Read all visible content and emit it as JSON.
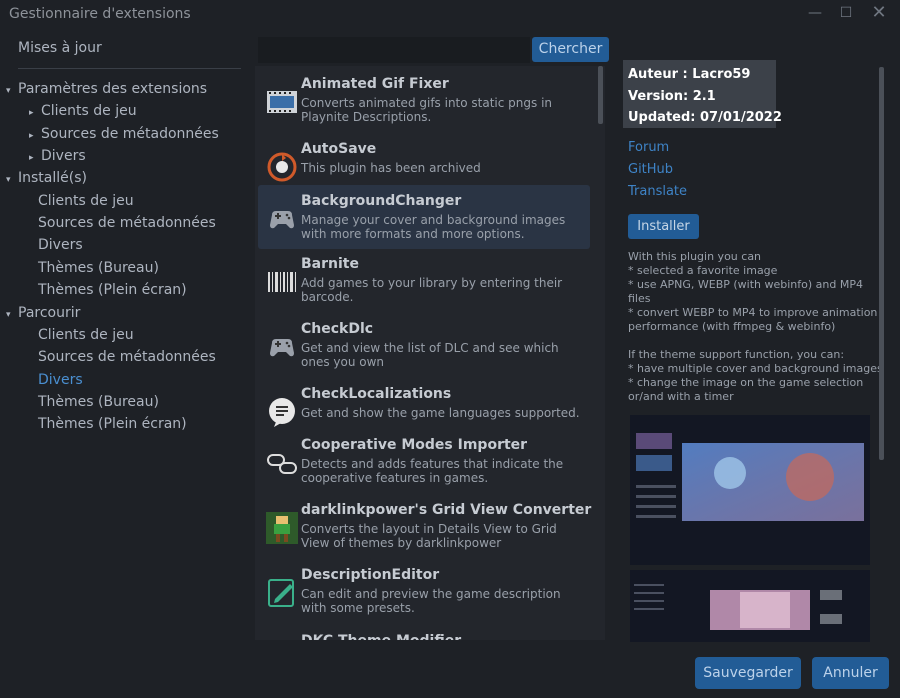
{
  "window": {
    "title": "Gestionnaire d'extensions"
  },
  "nav": {
    "updates": "Mises à jour",
    "rows": [
      {
        "label": "Paramètres des extensions",
        "arrow": "▾",
        "level": 0
      },
      {
        "label": "Clients de jeu",
        "arrow": "▸",
        "level": 1
      },
      {
        "label": "Sources de métadonnées",
        "arrow": "▸",
        "level": 1
      },
      {
        "label": "Divers",
        "arrow": "▸",
        "level": 1
      },
      {
        "label": "Installé(s)",
        "arrow": "▾",
        "level": 0
      },
      {
        "label": "Clients de jeu",
        "arrow": "",
        "level": 1
      },
      {
        "label": "Sources de métadonnées",
        "arrow": "",
        "level": 1
      },
      {
        "label": "Divers",
        "arrow": "",
        "level": 1
      },
      {
        "label": "Thèmes (Bureau)",
        "arrow": "",
        "level": 1
      },
      {
        "label": "Thèmes (Plein écran)",
        "arrow": "",
        "level": 1
      },
      {
        "label": "Parcourir",
        "arrow": "▾",
        "level": 0
      },
      {
        "label": "Clients de jeu",
        "arrow": "",
        "level": 1
      },
      {
        "label": "Sources de métadonnées",
        "arrow": "",
        "level": 1
      },
      {
        "label": "Divers",
        "arrow": "",
        "level": 1,
        "active": true
      },
      {
        "label": "Thèmes (Bureau)",
        "arrow": "",
        "level": 1
      },
      {
        "label": "Thèmes (Plein écran)",
        "arrow": "",
        "level": 1
      }
    ]
  },
  "search": {
    "value": "",
    "button": "Chercher"
  },
  "extensions": [
    {
      "name": "Animated Gif Fixer",
      "desc": "Converts animated gifs into static pngs in Playnite Descriptions.",
      "icon": "film-icon"
    },
    {
      "name": "AutoSave",
      "desc": "This plugin has been archived",
      "icon": "autosave-icon"
    },
    {
      "name": "BackgroundChanger",
      "desc": "Manage your cover and background images with more formats and more options.",
      "icon": "gamepad-icon",
      "selected": true
    },
    {
      "name": "Barnite",
      "desc": "Add games to your library by entering their barcode.",
      "icon": "barcode-icon"
    },
    {
      "name": "CheckDlc",
      "desc": "Get and view the list of DLC and see which ones you own",
      "icon": "gamepad-icon"
    },
    {
      "name": "CheckLocalizations",
      "desc": "Get and show the game languages supported.",
      "icon": "speech-bubble-icon"
    },
    {
      "name": "Cooperative Modes Importer",
      "desc": "Detects and adds features that indicate the cooperative features in games.",
      "icon": "coop-gamepads-icon"
    },
    {
      "name": "darklinkpower's Grid View Converter",
      "desc": "Converts the layout in Details View to Grid View of themes by darklinkpower",
      "icon": "pixel-character-icon"
    },
    {
      "name": "DescriptionEditor",
      "desc": "Can edit and preview the game description with some presets.",
      "icon": "edit-icon"
    },
    {
      "name": "DKC Theme Modifier",
      "desc": "",
      "icon": "theme-icon"
    }
  ],
  "details": {
    "author_label": "Auteur :",
    "author": "Lacro59",
    "version_label": "Version:",
    "version": "2.1",
    "updated_label": "Updated:",
    "updated": "07/01/2022",
    "links": [
      "Forum",
      "GitHub",
      "Translate"
    ],
    "install": "Installer",
    "description": [
      "With this plugin you can",
      "* selected a favorite image",
      "* use APNG, WEBP (with webinfo) and MP4",
      "files",
      "* convert WEBP to MP4 to improve animation",
      "performance (with ffmpeg & webinfo)",
      "",
      "If the theme support function, you can:",
      "* have multiple cover and background images",
      "* change the image on the game selection",
      "or/and with a timer"
    ]
  },
  "footer": {
    "save": "Sauvegarder",
    "cancel": "Annuler"
  },
  "colors": {
    "accent": "#225c96",
    "link": "#3e83c6",
    "active_nav": "#4a8fd1",
    "background": "#1e2126"
  }
}
